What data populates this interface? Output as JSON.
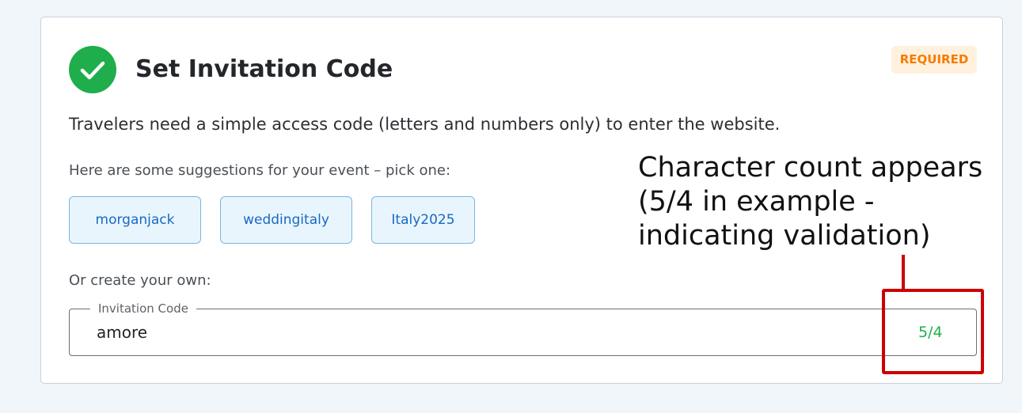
{
  "card": {
    "title": "Set Invitation Code",
    "badge": "REQUIRED",
    "description": "Travelers need a simple access code (letters and numbers only) to enter the website.",
    "suggestions_label": "Here are some suggestions for your event – pick one:",
    "suggestions": [
      "morganjack",
      "weddingitaly",
      "Italy2025"
    ],
    "own_label": "Or create your own:",
    "field": {
      "label": "Invitation Code",
      "value": "amore",
      "char_count": "5/4"
    }
  },
  "annotation": {
    "lines": [
      "Character count appears",
      "(5/4 in example -",
      "indicating validation)"
    ]
  },
  "colors": {
    "success_green": "#1fae4b",
    "badge_orange": "#f57c00",
    "chip_blue": "#1769c2",
    "annotation_red": "#cc0000"
  },
  "icons": {
    "status": "check-circle-icon"
  }
}
